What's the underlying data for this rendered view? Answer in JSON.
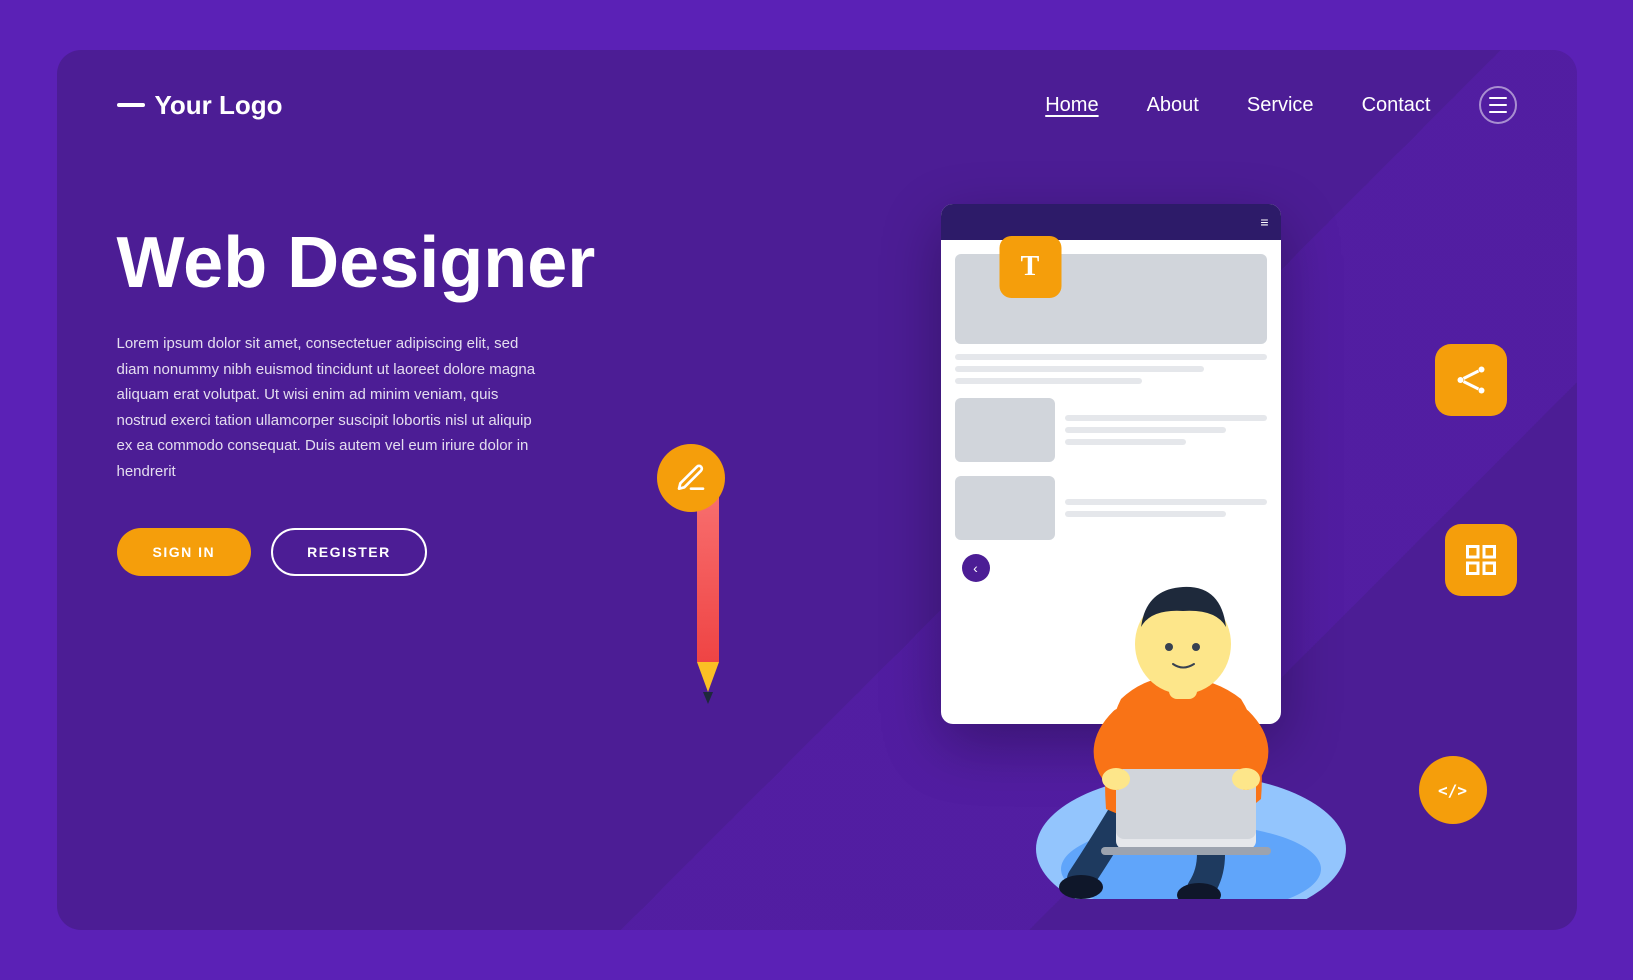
{
  "brand": {
    "logo_dash": "—",
    "logo_text": "Your Logo"
  },
  "navbar": {
    "links": [
      {
        "label": "Home",
        "active": true
      },
      {
        "label": "About",
        "active": false
      },
      {
        "label": "Service",
        "active": false
      },
      {
        "label": "Contact",
        "active": false
      }
    ]
  },
  "hero": {
    "title": "Web Designer",
    "description": "Lorem ipsum dolor sit amet, consectetuer adipiscing elit, sed diam nonummy nibh euismod tincidunt ut laoreet dolore magna aliquam erat volutpat. Ut wisi enim ad minim veniam, quis nostrud exerci tation ullamcorper suscipit lobortis nisl ut aliquip ex ea commodo consequat. Duis autem vel eum iriure dolor in hendrerit",
    "btn_signin": "SIGN IN",
    "btn_register": "REGISTER"
  },
  "illustration": {
    "icons": {
      "text_type": "T",
      "pen": "✒",
      "node": "⬡",
      "grid": "⊞",
      "code": "</>"
    }
  },
  "colors": {
    "bg_outer": "#5b21b6",
    "bg_inner": "#4c1d95",
    "accent_yellow": "#f59e0b",
    "btn_register_border": "#ffffff",
    "nav_active_underline": "#ffffff"
  }
}
